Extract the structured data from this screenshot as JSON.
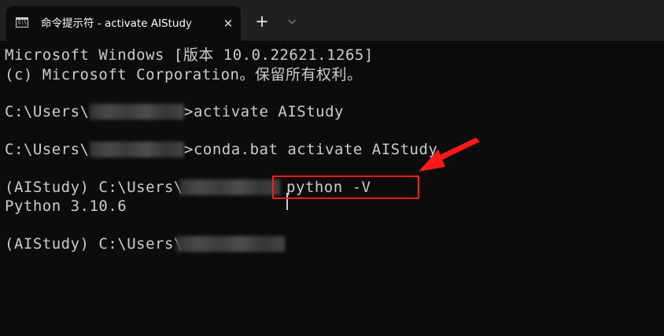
{
  "window": {
    "tab_title": "命令提示符 - activate  AIStudy",
    "close_glyph": "✕",
    "new_tab_glyph": "+",
    "dropdown_glyph": "⌵"
  },
  "icons": {
    "tab_icon": "terminal-icon",
    "tab_icon_glyph": "C:\\",
    "close": "close-icon",
    "new_tab": "plus-icon",
    "dropdown": "chevron-down-icon"
  },
  "terminal": {
    "lines": [
      "Microsoft Windows [版本 10.0.22621.1265]",
      "(c) Microsoft Corporation。保留所有权利。",
      "C:\\Users\\",
      ">activate AIStudy",
      "C:\\Users\\",
      ">conda.bat activate AIStudy",
      "(AIStudy) C:\\Users\\",
      "python -V",
      "Python 3.10.6",
      "(AIStudy) C:\\Users\\"
    ]
  },
  "annotation": {
    "highlight_color": "#ff1a1a"
  },
  "colors": {
    "background": "#0c0c0c",
    "titlebar": "#202020",
    "text": "#cccccc"
  }
}
